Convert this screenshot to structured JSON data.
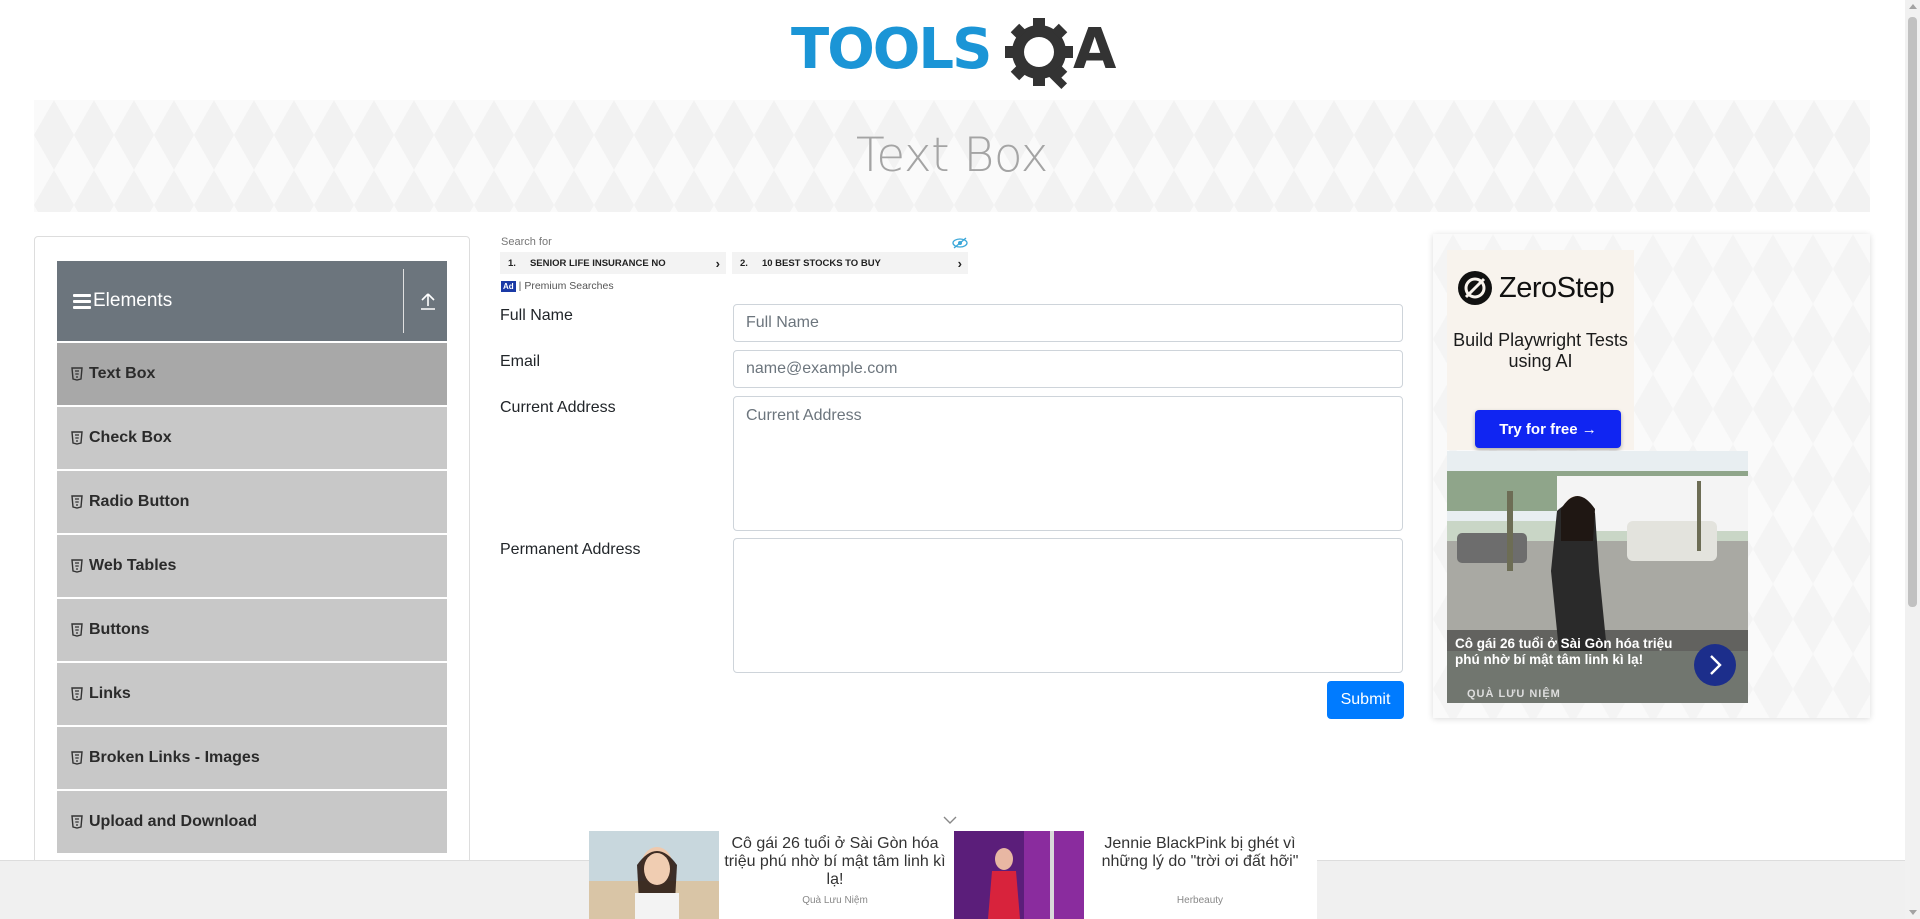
{
  "header": {
    "logo_text": "TOOLSQA"
  },
  "banner": {
    "title": "Text Box"
  },
  "sidebar": {
    "group_title": "Elements",
    "items": [
      {
        "label": "Text Box",
        "active": true
      },
      {
        "label": "Check Box"
      },
      {
        "label": "Radio Button"
      },
      {
        "label": "Web Tables"
      },
      {
        "label": "Buttons"
      },
      {
        "label": "Links"
      },
      {
        "label": "Broken Links - Images"
      },
      {
        "label": "Upload and Download"
      }
    ]
  },
  "search_ad": {
    "label": "Search for",
    "results": [
      {
        "num": "1.",
        "text": "SENIOR LIFE INSURANCE NO"
      },
      {
        "num": "2.",
        "text": "10 BEST STOCKS TO BUY"
      }
    ],
    "badge": "Ad",
    "footer": "| Premium Searches"
  },
  "form": {
    "full_name": {
      "label": "Full Name",
      "value": "",
      "placeholder": "Full Name"
    },
    "email": {
      "label": "Email",
      "value": "",
      "placeholder": "name@example.com"
    },
    "current_address": {
      "label": "Current Address",
      "value": "",
      "placeholder": "Current Address"
    },
    "permanent_address": {
      "label": "Permanent Address",
      "value": "",
      "placeholder": ""
    },
    "submit_label": "Submit"
  },
  "right_ad": {
    "brand": "ZeroStep",
    "tagline": "Build Playwright Tests using AI",
    "cta": "Try for free →",
    "photo_caption": "Cô gái 26 tuổi ở Sài Gòn hóa triệu phú nhờ bí mật tâm linh kì lạ!",
    "photo_source": "QUÀ LƯU NIỆM"
  },
  "bottom_ad": {
    "items": [
      {
        "text": "Cô gái 26 tuổi ở Sài Gòn hóa triệu phú nhờ bí mật tâm linh kì lạ!",
        "source": "Quà Lưu Niệm"
      },
      {
        "text": "Jennie BlackPink bị ghét vì những lý do \"trời ơi đất hỡi\"",
        "source": "Herbeauty"
      }
    ]
  },
  "colors": {
    "primary": "#007bff",
    "sidebar_header": "#6c757d",
    "sidebar_item": "#c8c8c8",
    "sidebar_active": "#a8a8a8",
    "logo_blue": "#1b95d6"
  }
}
